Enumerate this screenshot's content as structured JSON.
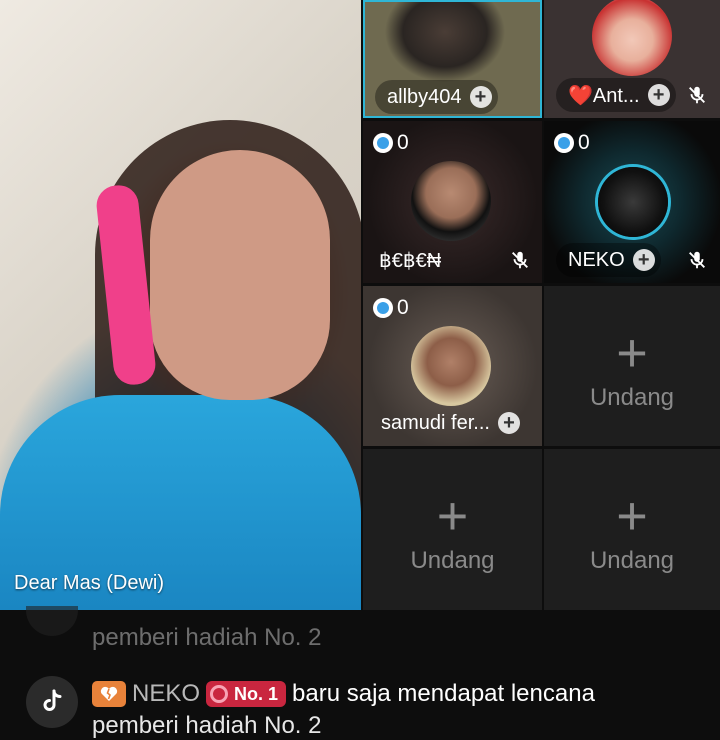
{
  "host": {
    "name": "Dear Mas (Dewi)"
  },
  "guests": [
    {
      "name": "allby404",
      "mic_muted": false
    },
    {
      "name": "❤️Ant...",
      "mic_muted": true
    },
    {
      "name": "฿€฿€₦",
      "coins": "0",
      "mic_muted": true
    },
    {
      "name": "NEKO",
      "coins": "0",
      "mic_muted": true
    },
    {
      "name": "samudi fer...",
      "coins": "0",
      "mic_muted": false
    }
  ],
  "invite_label": "Undang",
  "comments": [
    {
      "text": "pemberi hadiah No. 2"
    },
    {
      "badge_icon": "broken-heart-icon",
      "user": "NEKO",
      "rank": "No. 1",
      "message": "baru saja mendapat lencana",
      "cont": "pemberi hadiah No. 2"
    }
  ],
  "colors": {
    "background": "#0d0d0d",
    "rank_badge": "#c9263f",
    "fan_badge": "#e8823a",
    "gem": "#3aa0e8"
  }
}
